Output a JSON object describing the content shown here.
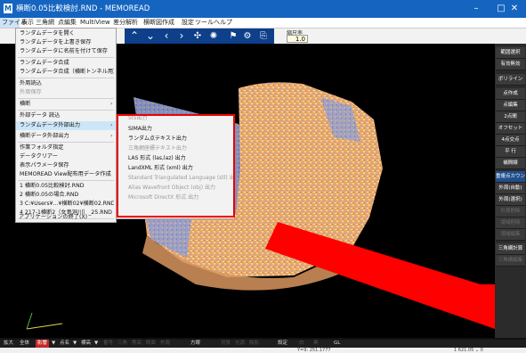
{
  "window": {
    "title": "横断0.05比較検討.RND - MEMOREAD",
    "app_icon": "M",
    "controls": {
      "minimize": "–",
      "maximize": "□",
      "close": "✕"
    }
  },
  "menubar": {
    "items": [
      "ファイル",
      "表示",
      "三角網",
      "点編集",
      "MultiView",
      "差分解析",
      "横断図作成",
      "設定",
      "ツール",
      "ヘルプ"
    ]
  },
  "toolbar": {
    "icons": [
      "chevron-up-icon",
      "chevron-down-icon",
      "chevron-left-icon",
      "chevron-right-icon",
      "camera-icon",
      "gear-icon",
      "flag-icon",
      "settings-icon",
      "export-icon"
    ],
    "zoom_label": "縮尺率",
    "zoom_value": "1.0"
  },
  "file_menu": {
    "items": [
      {
        "label": "ランダムデータを開く",
        "enabled": true
      },
      {
        "label": "ランダムデータを上書き保存",
        "enabled": true
      },
      {
        "label": "ランダムデータに名前を付けて保存",
        "enabled": true
      },
      {
        "label": "ランダムデータ合成",
        "enabled": true
      },
      {
        "label": "ランダムデータ合成（横断トンネル用）",
        "enabled": true
      },
      {
        "label": "外周読込",
        "enabled": true
      },
      {
        "label": "外周保存",
        "enabled": false
      },
      {
        "label": "横断",
        "enabled": true
      },
      {
        "label": "外部データ 読込",
        "enabled": true
      },
      {
        "label": "ランダムデータ外部出力",
        "enabled": true
      },
      {
        "label": "横断データ外部出力",
        "enabled": true
      },
      {
        "label": "作業フォルダ指定",
        "enabled": true
      },
      {
        "label": "データクリアー",
        "enabled": true
      },
      {
        "label": "表示パラメータ保存",
        "enabled": true
      },
      {
        "label": "MEMOREAD View配布用データ作成",
        "enabled": true
      },
      {
        "label": "1 横断0.05比較検討.RND",
        "enabled": true
      },
      {
        "label": "2 横断0.05の場合.RND",
        "enabled": true
      },
      {
        "label": "3 C:¥Users¥...¥横断02¥横断02.RND",
        "enabled": true
      },
      {
        "label": "4 217-1横断2（女島洞川）_25.RND",
        "enabled": true
      },
      {
        "label": "アプリケーションの終了(X)",
        "enabled": true
      }
    ]
  },
  "export_submenu": {
    "items": [
      {
        "label": "SIS出力",
        "enabled": false
      },
      {
        "label": "SIMA出力",
        "enabled": true
      },
      {
        "label": "ランダム点テキスト出力",
        "enabled": true
      },
      {
        "label": "三角網座標テキスト出力",
        "enabled": false
      },
      {
        "label": "LAS 形式 (las,laz) 出力",
        "enabled": true
      },
      {
        "label": "LandXML 形式 (xml) 出力",
        "enabled": true
      },
      {
        "label": "Standard Triangulated Language (stl) 出力",
        "enabled": false
      },
      {
        "label": "Alias Wavefront Object (obj) 出力",
        "enabled": false
      },
      {
        "label": "Microsoft DirectX 形式 出力",
        "enabled": false
      }
    ]
  },
  "right_panel": {
    "buttons": [
      {
        "label": "範囲選択",
        "state": "normal"
      },
      {
        "label": "有効無効",
        "state": "normal"
      },
      {
        "label": "ポリライン",
        "state": "normal"
      },
      {
        "label": "点作成",
        "state": "normal"
      },
      {
        "label": "点編集",
        "state": "normal"
      },
      {
        "label": "2点間",
        "state": "normal"
      },
      {
        "label": "オフセット",
        "state": "normal"
      },
      {
        "label": "4点交点",
        "state": "normal"
      },
      {
        "label": "平 行",
        "state": "normal"
      },
      {
        "label": "補間線",
        "state": "normal"
      },
      {
        "label": "重複点カウント",
        "state": "blue"
      },
      {
        "label": "外周(自動)",
        "state": "normal"
      },
      {
        "label": "外周(選択)",
        "state": "normal"
      },
      {
        "label": "外周削除",
        "state": "dim"
      },
      {
        "label": "領域削除",
        "state": "dim"
      },
      {
        "label": "領域編集",
        "state": "dim"
      },
      {
        "label": "三角網計算",
        "state": "normal"
      },
      {
        "label": "三角網編集",
        "state": "dim"
      }
    ]
  },
  "bottom_bar": {
    "items": [
      {
        "label": "拡大",
        "style": "normal"
      },
      {
        "label": "全体",
        "style": "normal"
      },
      {
        "label": "影響",
        "style": "red"
      },
      {
        "label": "▼",
        "style": "normal"
      },
      {
        "label": "点名",
        "style": "normal"
      },
      {
        "label": "▼",
        "style": "normal"
      },
      {
        "label": "標高",
        "style": "normal"
      },
      {
        "label": "▼",
        "style": "normal"
      },
      {
        "label": "番号",
        "style": "dim"
      },
      {
        "label": "三角",
        "style": "dim"
      },
      {
        "label": "等高",
        "style": "dim"
      },
      {
        "label": "断面",
        "style": "dim"
      },
      {
        "label": "外周",
        "style": "dim"
      },
      {
        "label": "方眼",
        "style": "normal"
      },
      {
        "label": "背景",
        "style": "dim"
      },
      {
        "label": "光源",
        "style": "dim"
      },
      {
        "label": "陰影",
        "style": "dim"
      },
      {
        "label": "設定",
        "style": "normal"
      },
      {
        "label": "白",
        "style": "dim"
      },
      {
        "label": "黒",
        "style": "dim"
      },
      {
        "label": "GL",
        "style": "normal"
      }
    ]
  },
  "status": {
    "left": "",
    "mid": "Y=9: 251.1777",
    "right": "1 621.05 ⌄  0"
  },
  "colors": {
    "titlebar": "#1565c0",
    "highlight_box": "#e00000",
    "red_arrow": "#ff0000"
  }
}
